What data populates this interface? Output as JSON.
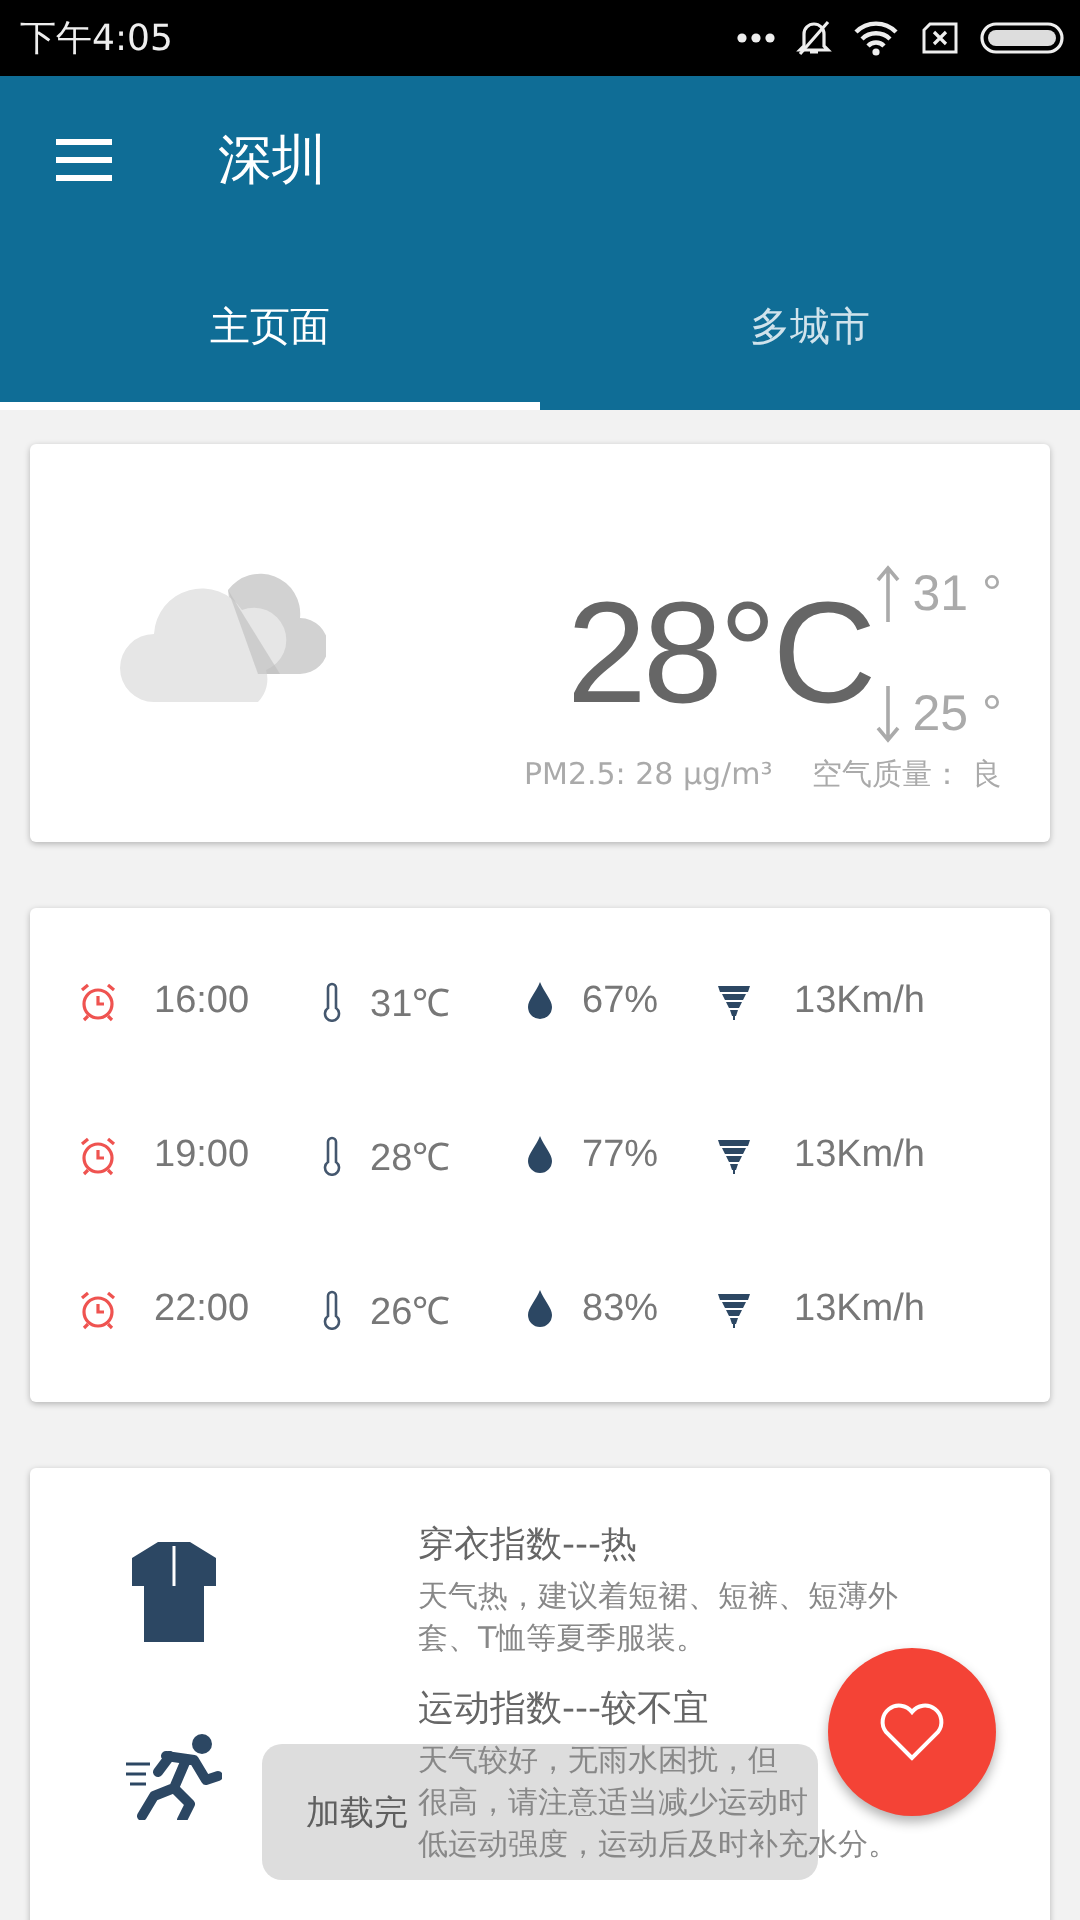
{
  "status_bar": {
    "time": "下午4:05"
  },
  "toolbar": {
    "title": "深圳"
  },
  "tabs": [
    {
      "label": "主页面",
      "selected": true
    },
    {
      "label": "多城市",
      "selected": false
    }
  ],
  "current": {
    "temperature": "28°C",
    "high": "31 °",
    "low": "25 °",
    "pm25": "PM2.5: 28 μg/m³",
    "air_quality": "空气质量： 良"
  },
  "forecast": [
    {
      "time": "16:00",
      "temp": "31℃",
      "humidity": "67%",
      "wind": "13Km/h"
    },
    {
      "time": "19:00",
      "temp": "28℃",
      "humidity": "77%",
      "wind": "13Km/h"
    },
    {
      "time": "22:00",
      "temp": "26℃",
      "humidity": "83%",
      "wind": "13Km/h"
    }
  ],
  "suggestions": [
    {
      "kind": "clothing",
      "title": "穿衣指数---热",
      "lines": [
        "天气热，建议着短裙、短裤、短薄外",
        "套、T恤等夏季服装。"
      ]
    },
    {
      "kind": "sport",
      "title": "运动指数---较不宜",
      "lines": [
        "天气较好，无雨水困扰，但",
        "很高，请注意适当减少运动时",
        "低运动强度，运动后及时补充水分。"
      ]
    }
  ],
  "toast": "加载完"
}
